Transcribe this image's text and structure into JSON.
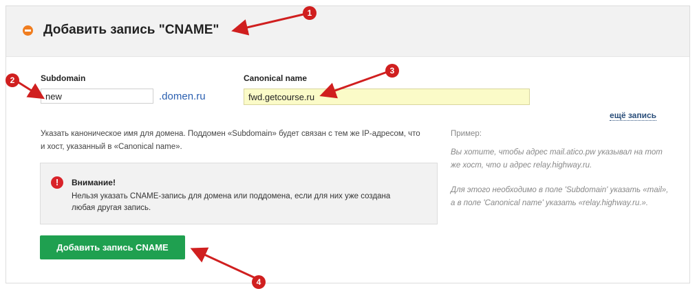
{
  "header": {
    "title": "Добавить запись \"CNAME\""
  },
  "form": {
    "subdomain_label": "Subdomain",
    "subdomain_value": "new",
    "domain_suffix": ".domen.ru",
    "canonical_label": "Canonical name",
    "canonical_value": "fwd.getcourse.ru",
    "more_link": "ещё запись",
    "description": "Указать каноническое имя для домена. Поддомен «Subdomain» будет связан с тем же IP-адресом, что и хост, указанный в «Canonical name».",
    "warning_title": "Внимание!",
    "warning_text": "Нельзя указать CNAME-запись для домена или поддомена, если для них уже создана любая другая запись.",
    "submit_label": "Добавить запись CNAME"
  },
  "example": {
    "title": "Пример:",
    "line1": "Вы хотите, чтобы адрес mail.atico.pw указывал на тот же хост, что и адрес relay.highway.ru.",
    "line2": "Для этого необходимо в поле 'Subdomain' указать «mail», а в поле 'Canonical name' указать «relay.highway.ru.»."
  },
  "annotations": [
    "1",
    "2",
    "3",
    "4"
  ],
  "colors": {
    "accent_orange": "#f07d1f",
    "button_green": "#1fa050",
    "annotation_red": "#d01f1f",
    "warning_red": "#d9232a",
    "input_highlight": "#fbfbc8"
  }
}
